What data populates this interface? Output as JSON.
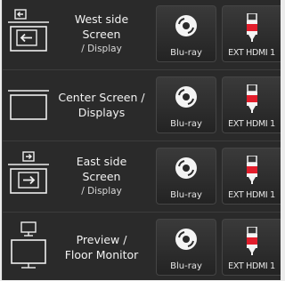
{
  "rows": [
    {
      "id": "west",
      "line1": "West side",
      "line2": "Screen",
      "line3": "/ Display",
      "icon": "left-arrow-screen-icon"
    },
    {
      "id": "center",
      "line1": "Center Screen /",
      "line2": "Displays",
      "line3": "",
      "icon": "screen-icon"
    },
    {
      "id": "east",
      "line1": "East side",
      "line2": "Screen",
      "line3": "/ Display",
      "icon": "right-arrow-screen-icon"
    },
    {
      "id": "preview",
      "line1": "Preview /",
      "line2": "Floor Monitor",
      "line3": "",
      "icon": "monitor-icon"
    }
  ],
  "sources": {
    "bluray_label": "Blu-ray",
    "hdmi_label": "EXT HDMI 1",
    "bluray_icon": "disc-icon",
    "hdmi_icon": "hdmi-cable-icon"
  },
  "colors": {
    "background": "#2a2a2a",
    "text": "#f2f2f2",
    "hdmi_red": "#e21d2b"
  }
}
